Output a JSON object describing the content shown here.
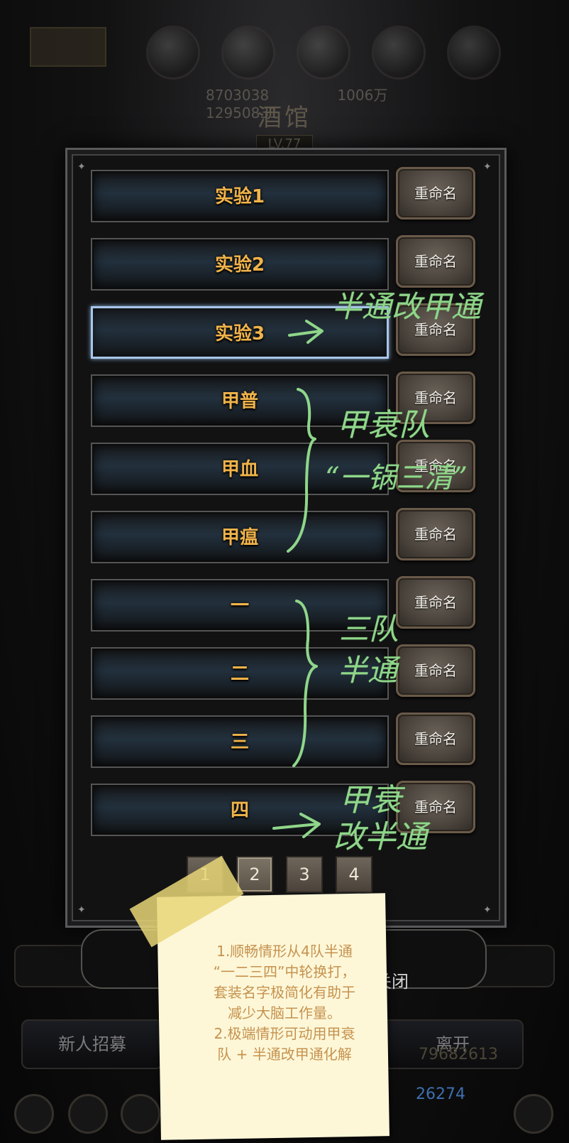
{
  "resources": {
    "numbers": [
      "8703038",
      "1006万",
      "12950831"
    ]
  },
  "tavern": {
    "title": "酒馆",
    "level": "LV.77"
  },
  "dialog": {
    "teams": [
      {
        "name": "实验1",
        "rename": "重命名",
        "selected": false
      },
      {
        "name": "实验2",
        "rename": "重命名",
        "selected": false
      },
      {
        "name": "实验3",
        "rename": "重命名",
        "selected": true
      },
      {
        "name": "甲普",
        "rename": "重命名",
        "selected": false
      },
      {
        "name": "甲血",
        "rename": "重命名",
        "selected": false
      },
      {
        "name": "甲瘟",
        "rename": "重命名",
        "selected": false
      },
      {
        "name": "一",
        "rename": "重命名",
        "selected": false
      },
      {
        "name": "二",
        "rename": "重命名",
        "selected": false
      },
      {
        "name": "三",
        "rename": "重命名",
        "selected": false
      },
      {
        "name": "四",
        "rename": "重命名",
        "selected": false
      }
    ],
    "pages": [
      "1",
      "2",
      "3",
      "4"
    ],
    "active_page": "2",
    "close_label": "关闭"
  },
  "bottom_bar": {
    "recruit": "新人招募",
    "leave": "离开",
    "coins": "79682613",
    "gems": "26274"
  },
  "note": {
    "lines": [
      "1.顺畅情形从4队半通",
      "“一二三四”中轮换打，",
      "套装名字极简化有助于",
      "减少大脑工作量。",
      "2.极端情形可动用甲衰",
      "队 + 半通改甲通化解"
    ]
  },
  "annotations": {
    "row3": "半通改甲通",
    "jia_team": "甲衰队",
    "jia_sub": "“一锅三清”",
    "three_team_1": "三队",
    "three_team_2": "半通",
    "row10_1": "甲衰",
    "row10_2": "改半通",
    "colors": {
      "handwriting": "#8fd68a",
      "team_name": "#f0b34a",
      "note_text": "#c6924e"
    }
  }
}
